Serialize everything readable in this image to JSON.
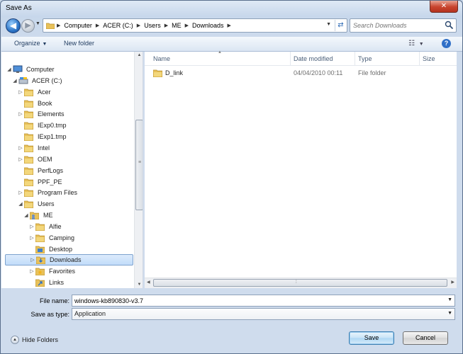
{
  "window": {
    "title": "Save As",
    "close_glyph": "✕"
  },
  "nav": {
    "breadcrumbs": [
      "Computer",
      "ACER (C:)",
      "Users",
      "ME",
      "Downloads"
    ],
    "search_placeholder": "Search Downloads"
  },
  "toolbar": {
    "organize": "Organize",
    "new_folder": "New folder"
  },
  "tree": {
    "items": [
      {
        "label": "Computer",
        "icon": "computer-icon",
        "level": 0,
        "arrow": "◢"
      },
      {
        "label": "ACER (C:)",
        "icon": "drive-icon",
        "level": 1,
        "arrow": "◢"
      },
      {
        "label": "Acer",
        "icon": "folder-icon",
        "level": 2,
        "arrow": "▷"
      },
      {
        "label": "Book",
        "icon": "folder-icon",
        "level": 2,
        "arrow": ""
      },
      {
        "label": "Elements",
        "icon": "folder-icon",
        "level": 2,
        "arrow": "▷"
      },
      {
        "label": "IExp0.tmp",
        "icon": "folder-icon",
        "level": 2,
        "arrow": ""
      },
      {
        "label": "IExp1.tmp",
        "icon": "folder-icon",
        "level": 2,
        "arrow": ""
      },
      {
        "label": "Intel",
        "icon": "folder-icon",
        "level": 2,
        "arrow": "▷"
      },
      {
        "label": "OEM",
        "icon": "folder-icon",
        "level": 2,
        "arrow": "▷"
      },
      {
        "label": "PerfLogs",
        "icon": "folder-icon",
        "level": 2,
        "arrow": ""
      },
      {
        "label": "PPF_PE",
        "icon": "folder-icon",
        "level": 2,
        "arrow": ""
      },
      {
        "label": "Program Files",
        "icon": "folder-icon",
        "level": 2,
        "arrow": "▷"
      },
      {
        "label": "Users",
        "icon": "folder-icon",
        "level": 2,
        "arrow": "◢"
      },
      {
        "label": "ME",
        "icon": "user-folder-icon",
        "level": 3,
        "arrow": "◢"
      },
      {
        "label": "Alfie",
        "icon": "folder-icon",
        "level": 4,
        "arrow": "▷"
      },
      {
        "label": "Camping",
        "icon": "folder-icon",
        "level": 4,
        "arrow": "▷"
      },
      {
        "label": "Desktop",
        "icon": "desktop-folder-icon",
        "level": 4,
        "arrow": ""
      },
      {
        "label": "Downloads",
        "icon": "downloads-folder-icon",
        "level": 4,
        "arrow": "▷",
        "selected": true
      },
      {
        "label": "Favorites",
        "icon": "favorites-folder-icon",
        "level": 4,
        "arrow": "▷"
      },
      {
        "label": "Links",
        "icon": "links-folder-icon",
        "level": 4,
        "arrow": ""
      }
    ]
  },
  "files": {
    "columns": [
      "Name",
      "Date modified",
      "Type",
      "Size"
    ],
    "rows": [
      {
        "name": "D_link",
        "date": "04/04/2010 00:11",
        "type": "File folder",
        "size": ""
      }
    ]
  },
  "form": {
    "file_name_label": "File name:",
    "file_name_value": "windows-kb890830-v3.7",
    "save_type_label": "Save as type:",
    "save_type_value": "Application"
  },
  "footer": {
    "hide_folders": "Hide Folders",
    "save": "Save",
    "cancel": "Cancel"
  },
  "colors": {
    "accent": "#2f6fc7",
    "folder": "#e8c15a",
    "selection": "#c2dcf9"
  }
}
